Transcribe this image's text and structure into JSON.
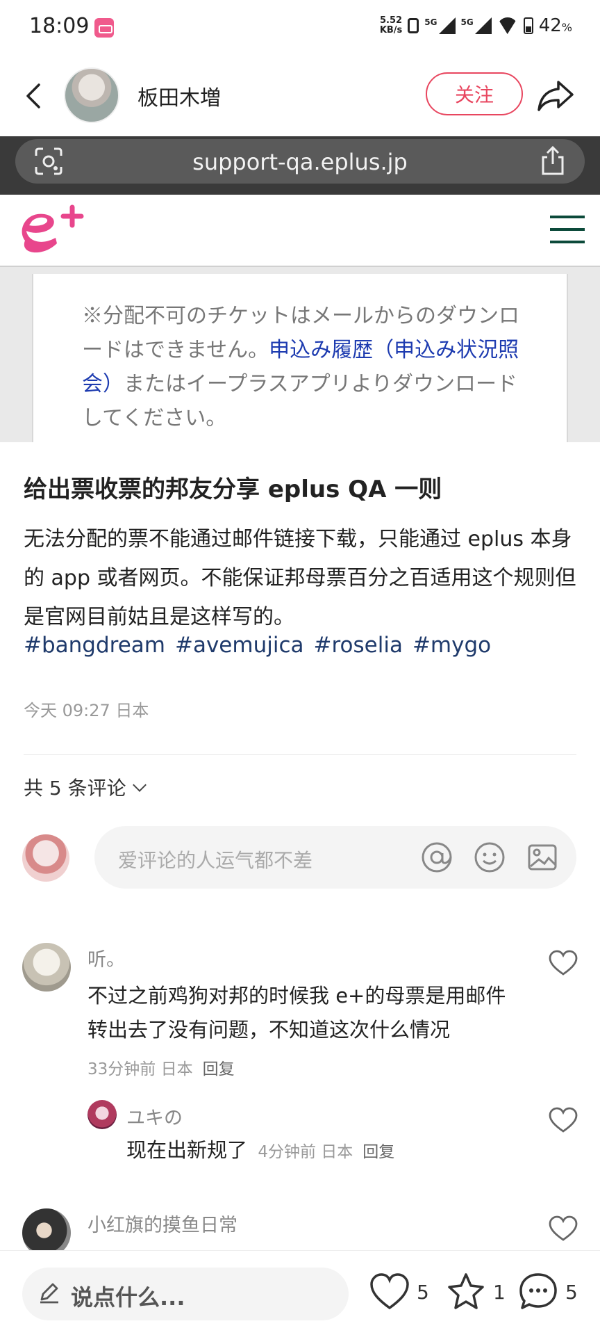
{
  "status_bar": {
    "time": "18:09",
    "speed_value": "5.52",
    "speed_unit": "KB/s",
    "net1": "5G",
    "net2": "5G",
    "battery_pct": "42",
    "battery_unit": "%"
  },
  "header": {
    "author_name": "板田木増",
    "follow_label": "关注"
  },
  "embedded_image": {
    "url": "support-qa.eplus.jp",
    "text_before": "※分配不可のチケットはメールからのダウンロードはできません。",
    "link_text": "申込み履歴（申込み状況照会）",
    "text_after": "またはイープラスアプリよりダウンロードしてください。"
  },
  "post": {
    "title": "给出票收票的邦友分享 eplus QA 一则",
    "body": "无法分配的票不能通过邮件链接下载，只能通过 eplus 本身的 app 或者网页。不能保证邦母票百分之百适用这个规则但是官网目前姑且是这样写的。",
    "hashtags": [
      "#bangdream",
      "#avemujica",
      "#roselia",
      "#mygo"
    ],
    "meta": "今天 09:27 日本"
  },
  "comments_section": {
    "count_label": "共 5 条评论",
    "input_placeholder": "爱评论的人运气都不差"
  },
  "comments": [
    {
      "user": "听。",
      "text": "不过之前鸡狗对邦的时候我 e+的母票是用邮件转出去了没有问题，不知道这次什么情况",
      "meta": "33分钟前 日本",
      "reply_label": "回复"
    },
    {
      "user": "ユキの",
      "text": "现在出新规了",
      "meta": "4分钟前 日本",
      "reply_label": "回复"
    },
    {
      "user": "小红旗的摸鱼日常"
    }
  ],
  "bottom_bar": {
    "say_placeholder": "说点什么...",
    "likes": "5",
    "collects": "1",
    "comments": "5"
  },
  "colors": {
    "accent": "#e8465f",
    "hashtag": "#1f3a6b",
    "eplus_pink": "#e8468c",
    "eplus_menu": "#0c4a3a"
  }
}
